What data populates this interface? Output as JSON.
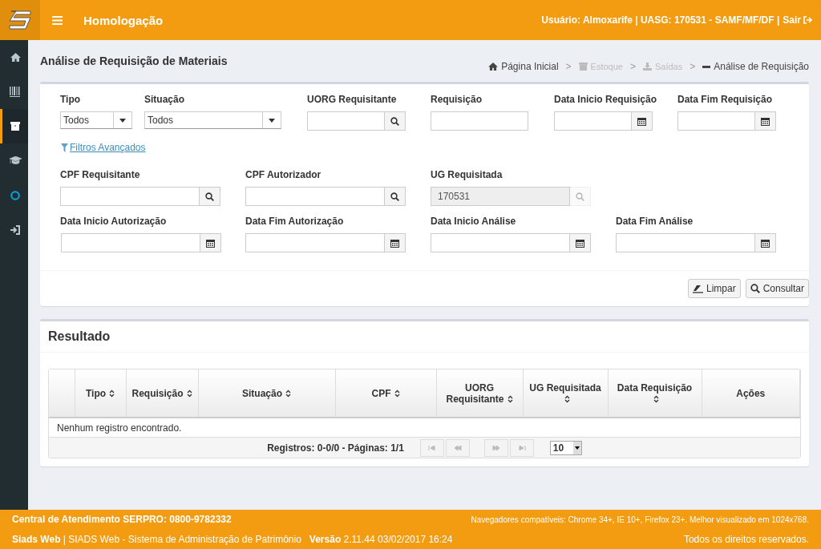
{
  "header": {
    "title": "Homologação",
    "user_info": "Usuário: Almoxarife | UASG: 170531 - SAMF/MF/DF |",
    "logout": "Sair"
  },
  "sidebar": {
    "items": [
      {
        "kind": "home",
        "selected": false
      },
      {
        "kind": "barcode",
        "selected": false
      },
      {
        "kind": "archive",
        "selected": true
      },
      {
        "kind": "graduation",
        "selected": false
      },
      {
        "kind": "circle",
        "selected": false
      },
      {
        "kind": "login",
        "selected": false
      }
    ]
  },
  "page_title": "Análise de Requisição de Materiais",
  "breadcrumb": [
    {
      "label": "Página Inicial",
      "kind": "home",
      "disabled": false
    },
    {
      "separator": ">",
      "label": "Estoque",
      "kind": "archive",
      "disabled": true
    },
    {
      "separator": ">",
      "label": "Saídas",
      "kind": "export",
      "disabled": true
    },
    {
      "separator": ">",
      "label": "Análise de Requisição",
      "kind": "minus",
      "disabled": false
    }
  ],
  "filter_rows": [
    [
      {
        "label": "Tipo",
        "kind": "select",
        "value": "Todos"
      },
      {
        "label": "Situação",
        "kind": "select",
        "value": "Todos"
      },
      {
        "label": "UORG Requisitante",
        "kind": "search"
      },
      {
        "label": "Requisição",
        "kind": "text"
      },
      {
        "label": "Data Inicio Requisição",
        "kind": "date"
      },
      {
        "label": "Data Fim Requisição",
        "kind": "date"
      }
    ],
    [
      {
        "label": "CPF Requisitante",
        "kind": "search"
      },
      {
        "label": "CPF Autorizador",
        "kind": "search"
      },
      {
        "label": "UG Requisitada",
        "kind": "search",
        "value": "170531",
        "disabled": true
      }
    ],
    [
      {
        "label": "Data Inicio Autorização",
        "kind": "date"
      },
      {
        "label": "Data Fim Autorização",
        "kind": "date"
      },
      {
        "label": "Data Inicio Análise",
        "kind": "date"
      },
      {
        "label": "Data Fim Análise",
        "kind": "date"
      }
    ]
  ],
  "advanced_filters_link": "Filtros Avançados",
  "actions": [
    {
      "label": "Limpar",
      "kind": "eraser"
    },
    {
      "label": "Consultar",
      "kind": "search"
    }
  ],
  "results": {
    "title": "Resultado",
    "columns": [
      {
        "sortable": false
      },
      {
        "label": "Tipo",
        "sortable": true
      },
      {
        "label": "Requisição",
        "sortable": true
      },
      {
        "label": "Situação",
        "sortable": true
      },
      {
        "label": "CPF",
        "sortable": true
      },
      {
        "label": "UORG Requisitante",
        "sortable": true
      },
      {
        "label": "UG Requisitada",
        "sortable": true
      },
      {
        "label": "Data Requisição",
        "sortable": true
      },
      {
        "label": "Ações",
        "sortable": false
      }
    ],
    "empty_message": "Nenhum registro encontrado.",
    "pager": {
      "summary": "Registros: 0-0/0 - Páginas: 1/1",
      "buttons": [
        {
          "kind": "first",
          "disabled": true
        },
        {
          "kind": "prev",
          "disabled": true
        },
        {
          "kind": "next",
          "disabled": true
        },
        {
          "kind": "last",
          "disabled": true
        }
      ],
      "page_size": "10"
    }
  },
  "footer": {
    "support": "Central de Atendimento SERPRO: 0800-9782332",
    "browsers": "Navegadores compatíveis: Chrome 34+, IE 10+, Firefox 23+. Melhor visualizado em 1024x768.",
    "system": "**Siads Web** | SIADS Web - Sistema de Administração de Patrimônio",
    "version_label": "Versão",
    "version": "2.11.44 03/02/2017 16:24",
    "rights": "Todos os direitos reservados."
  }
}
